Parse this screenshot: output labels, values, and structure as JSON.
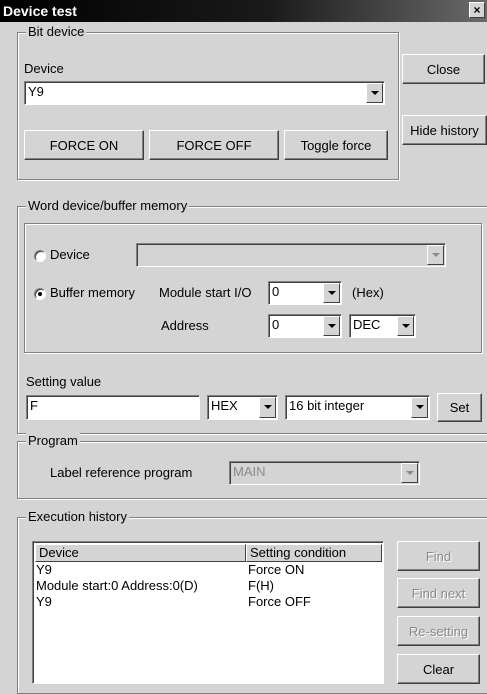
{
  "window": {
    "title": "Device test",
    "close_glyph": "×"
  },
  "bit_device": {
    "group_label": "Bit device",
    "device_label": "Device",
    "device_value": "Y9",
    "force_on": "FORCE ON",
    "force_off": "FORCE OFF",
    "toggle_force": "Toggle force"
  },
  "side_buttons": {
    "close": "Close",
    "hide_history": "Hide history"
  },
  "word_device": {
    "group_label": "Word device/buffer memory",
    "device_radio": "Device",
    "device_value": "",
    "buffer_radio": "Buffer memory",
    "module_start_label": "Module start I/O",
    "module_start_value": "0",
    "hex_label": "(Hex)",
    "address_label": "Address",
    "address_value": "0",
    "address_format": "DEC",
    "selected_radio": "Buffer memory"
  },
  "setting": {
    "label": "Setting value",
    "value": "F",
    "radix": "HEX",
    "type": "16 bit integer",
    "set_button": "Set"
  },
  "program": {
    "group_label": "Program",
    "label_ref": "Label reference program",
    "value": "MAIN"
  },
  "history": {
    "group_label": "Execution history",
    "columns": [
      "Device",
      "Setting condition"
    ],
    "rows": [
      {
        "device": "Y9",
        "condition": "Force ON"
      },
      {
        "device": "Module start:0 Address:0(D)",
        "condition": "F(H)"
      },
      {
        "device": "Y9",
        "condition": "Force OFF"
      }
    ],
    "buttons": {
      "find": "Find",
      "find_next": "Find next",
      "resetting": "Re-setting",
      "clear": "Clear"
    }
  }
}
